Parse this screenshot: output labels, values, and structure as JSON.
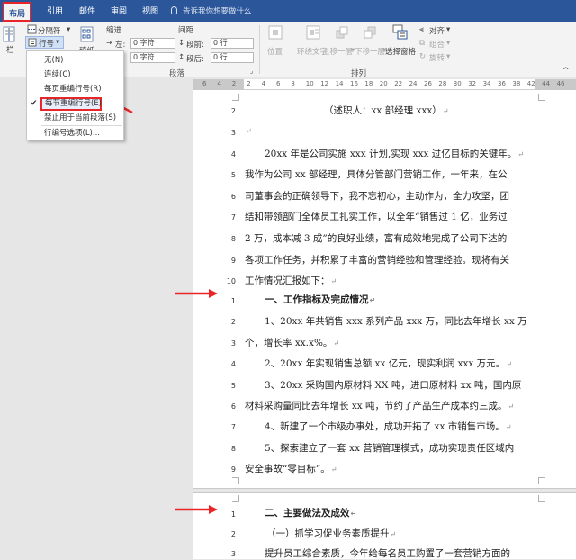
{
  "tabs": [
    {
      "label": "布局",
      "active": true
    },
    {
      "label": "引用"
    },
    {
      "label": "邮件"
    },
    {
      "label": "审阅"
    },
    {
      "label": "视图"
    }
  ],
  "tell_me": "告诉我你想要做什么",
  "ribbon": {
    "separator_label": "分隔符",
    "line_numbers_label": "行号",
    "hyphen_label": "断字",
    "lan_label": "栏",
    "draft_label": "稿纸",
    "indent_title": "缩进",
    "spacing_title": "间距",
    "indent_left_label": "左:",
    "indent_left_value": "0 字符",
    "indent_right_value": "0 字符",
    "spacing_before_label": "段前:",
    "spacing_before_value": "0 行",
    "spacing_after_label": "段后:",
    "spacing_after_value": "0 行",
    "paragraph_group": "段落",
    "position_label": "位置",
    "wrap_label": "环绕文字",
    "forward_label": "上移一层",
    "backward_label": "下移一层",
    "pane_label": "选择窗格",
    "align_label": "对齐",
    "group_label": "组合",
    "rotate_label": "旋转",
    "arrange_group": "排列"
  },
  "menu": {
    "items": [
      {
        "label": "无(N)"
      },
      {
        "label": "连续(C)"
      },
      {
        "label": "每页重编行号(R)"
      },
      {
        "label": "每节重编行号(E)",
        "checked": true
      },
      {
        "label": "禁止用于当前段落(S)"
      },
      {
        "label": "行编号选项(L)..."
      }
    ]
  },
  "ruler": {
    "numbers": [
      "6",
      "4",
      "2",
      "2",
      "4",
      "6",
      "8",
      "10",
      "12",
      "14",
      "16",
      "18",
      "20",
      "22",
      "24",
      "26",
      "28",
      "30",
      "32",
      "34",
      "36",
      "38",
      "42",
      "44",
      "46"
    ]
  },
  "document": {
    "lines": [
      {
        "num": "2",
        "text": "（述职人：xx 部经理 xxx）"
      },
      {
        "num": "3",
        "text": ""
      },
      {
        "num": "4",
        "text": "20xx 年是公司实施 xxx 计划,实现 xxx 过亿目标的关键年。"
      },
      {
        "num": "5",
        "text": "我作为公司 xx 部经理，具体分管部门营销工作，一年来，在公"
      },
      {
        "num": "6",
        "text": "司董事会的正确领导下，我不忘初心，主动作为，全力攻坚，团"
      },
      {
        "num": "7",
        "text": "结和带领部门全体员工扎实工作，以全年“销售过 1 亿，业务过"
      },
      {
        "num": "8",
        "text": "2 万，成本减 3 成”的良好业绩，富有成效地完成了公司下达的"
      },
      {
        "num": "9",
        "text": "各项工作任务，并积累了丰富的营销经验和管理经验。现将有关"
      },
      {
        "num": "10",
        "text": "工作情况汇报如下："
      },
      {
        "num": "1",
        "text": "一、工作指标及完成情况"
      },
      {
        "num": "2",
        "text": "1、20xx 年共销售 xxx 系列产品 xxx 万，同比去年增长 xx 万"
      },
      {
        "num": "3",
        "text": "个，增长率 xx.x%。"
      },
      {
        "num": "4",
        "text": "2、20xx 年实现销售总额 xx 亿元，现实利润 xxx 万元。"
      },
      {
        "num": "5",
        "text": "3、20xx 采购国内原材料 XX 吨，进口原材料 xx 吨，国内原"
      },
      {
        "num": "6",
        "text": "材料采购量同比去年增长 xx 吨，节约了产品生产成本约三成。"
      },
      {
        "num": "7",
        "text": "4、新建了一个市级办事处，成功开拓了 xx 市销售市场。"
      },
      {
        "num": "8",
        "text": "5、探索建立了一套 xx 营销管理模式，成功实现责任区域内"
      },
      {
        "num": "9",
        "text": "安全事故“零目标”。"
      },
      {
        "num": "1",
        "text": "二、主要做法及成效"
      },
      {
        "num": "2",
        "text": "（一）抓学习促业务素质提升"
      },
      {
        "num": "3",
        "text": "提升员工综合素质，今年给每名员工购置了一套营销方面的"
      }
    ]
  },
  "colors": {
    "accent": "#2b579a",
    "highlight": "#e8262a"
  }
}
